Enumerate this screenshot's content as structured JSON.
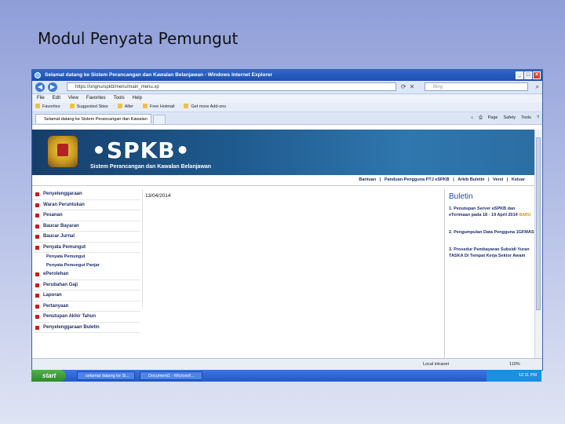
{
  "slide_title": "Modul Penyata Pemungut",
  "window": {
    "title": "Selamat datang ke Sistem Perancangan dan Kawalan Belanjawan - Windows Internet Explorer",
    "address": "https://ongnu/spkb/menu/main_menu.xp",
    "search_placeholder": "Bing"
  },
  "menubar": [
    "File",
    "Edit",
    "View",
    "Favorites",
    "Tools",
    "Help"
  ],
  "favbar": [
    "Favorites",
    "Suggested Sites",
    "Alfer",
    "Free Hotmail",
    "Get more Add-ons"
  ],
  "tab": {
    "label": "Selamat datang ke Sistem Perancangan dan Kawalan"
  },
  "commandbar": [
    "Page",
    "Safety",
    "Tools"
  ],
  "banner": {
    "logo": "•SPKB•",
    "subtitle": "Sistem Perancangan dan Kawalan Belanjawan"
  },
  "topnav": [
    "Bantuan",
    "|",
    "Panduan Pengguna PTJ eSPKB",
    "|",
    "Arkib Buletin",
    "|",
    "Versi",
    "|",
    "Keluar"
  ],
  "date": "13/04/2014",
  "sidebar": {
    "items": [
      "Penyelenggaraan",
      "Waran Peruntukan",
      "Pesanan",
      "Baucar Bayaran",
      "Baucar Jurnal",
      "Penyata Pemungut"
    ],
    "subitems": [
      "Penyata Pemungut",
      "Penyata Pemungut Panjar"
    ],
    "items_after": [
      "ePerolehan",
      "Perubahan Gaji",
      "Laporan",
      "Pertanyaan",
      "Penutupan Akhir Tahun",
      "Penyelenggaraan Buletin"
    ]
  },
  "buletin": {
    "title": "Buletin",
    "items": [
      {
        "text": "1. Penutupan Server eSPKB dan eTerimaan pada 18 - 19 April 2014",
        "badge": "BARU"
      },
      {
        "text": "2. Pengumpulan Data Pengguna 1GFMAS",
        "badge": ""
      },
      {
        "text": "3. Prosedur Pembayaran Subsidi Yuran TASKA Di Tempat Kerja Sektor Awam",
        "badge": ""
      }
    ]
  },
  "statusbar": {
    "zone": "Local intranet",
    "zoom": "110%"
  },
  "taskbar": {
    "start": "start",
    "items": [
      "selamat datang ke Si...",
      "Document1 - Microsof..."
    ],
    "clock": "12:11 PM"
  }
}
